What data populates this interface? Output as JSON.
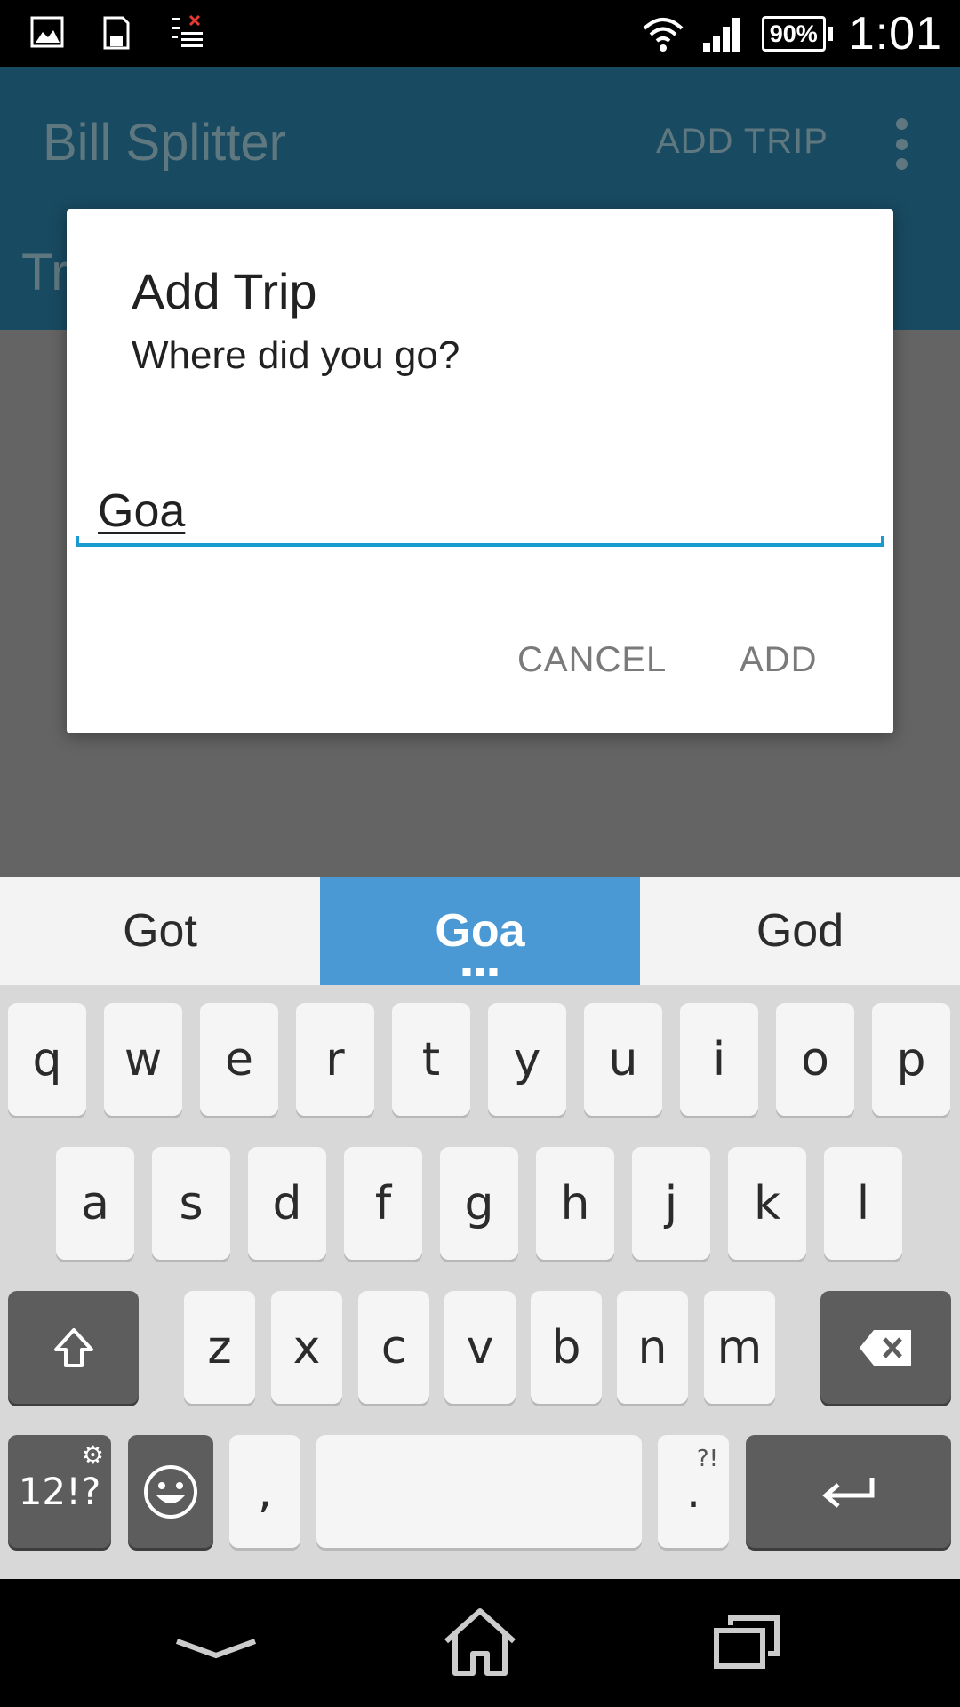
{
  "status_bar": {
    "battery": "90%",
    "time": "1:01",
    "icons": [
      "gallery-notification-icon",
      "sd-card-icon",
      "blocked-list-icon",
      "wifi-icon",
      "signal-icon",
      "battery-icon"
    ]
  },
  "app_bar": {
    "title": "Bill Splitter",
    "action": "ADD TRIP",
    "tab_partial": "Tr"
  },
  "dialog": {
    "title": "Add Trip",
    "message": "Where did you go?",
    "input_value": "Goa",
    "cancel": "CANCEL",
    "add": "ADD"
  },
  "suggestions": [
    "Got",
    "Goa",
    "God"
  ],
  "keyboard": {
    "row1": [
      "q",
      "w",
      "e",
      "r",
      "t",
      "y",
      "u",
      "i",
      "o",
      "p"
    ],
    "row2": [
      "a",
      "s",
      "d",
      "f",
      "g",
      "h",
      "j",
      "k",
      "l"
    ],
    "row3": [
      "z",
      "x",
      "c",
      "v",
      "b",
      "n",
      "m"
    ],
    "symbols_key": "12!?",
    "comma_key": ",",
    "period_key": ".",
    "period_hint": "?!"
  },
  "colors": {
    "app_bar": "#184a61",
    "accent": "#1a9bd0",
    "suggestion_active": "#4a98d4"
  }
}
